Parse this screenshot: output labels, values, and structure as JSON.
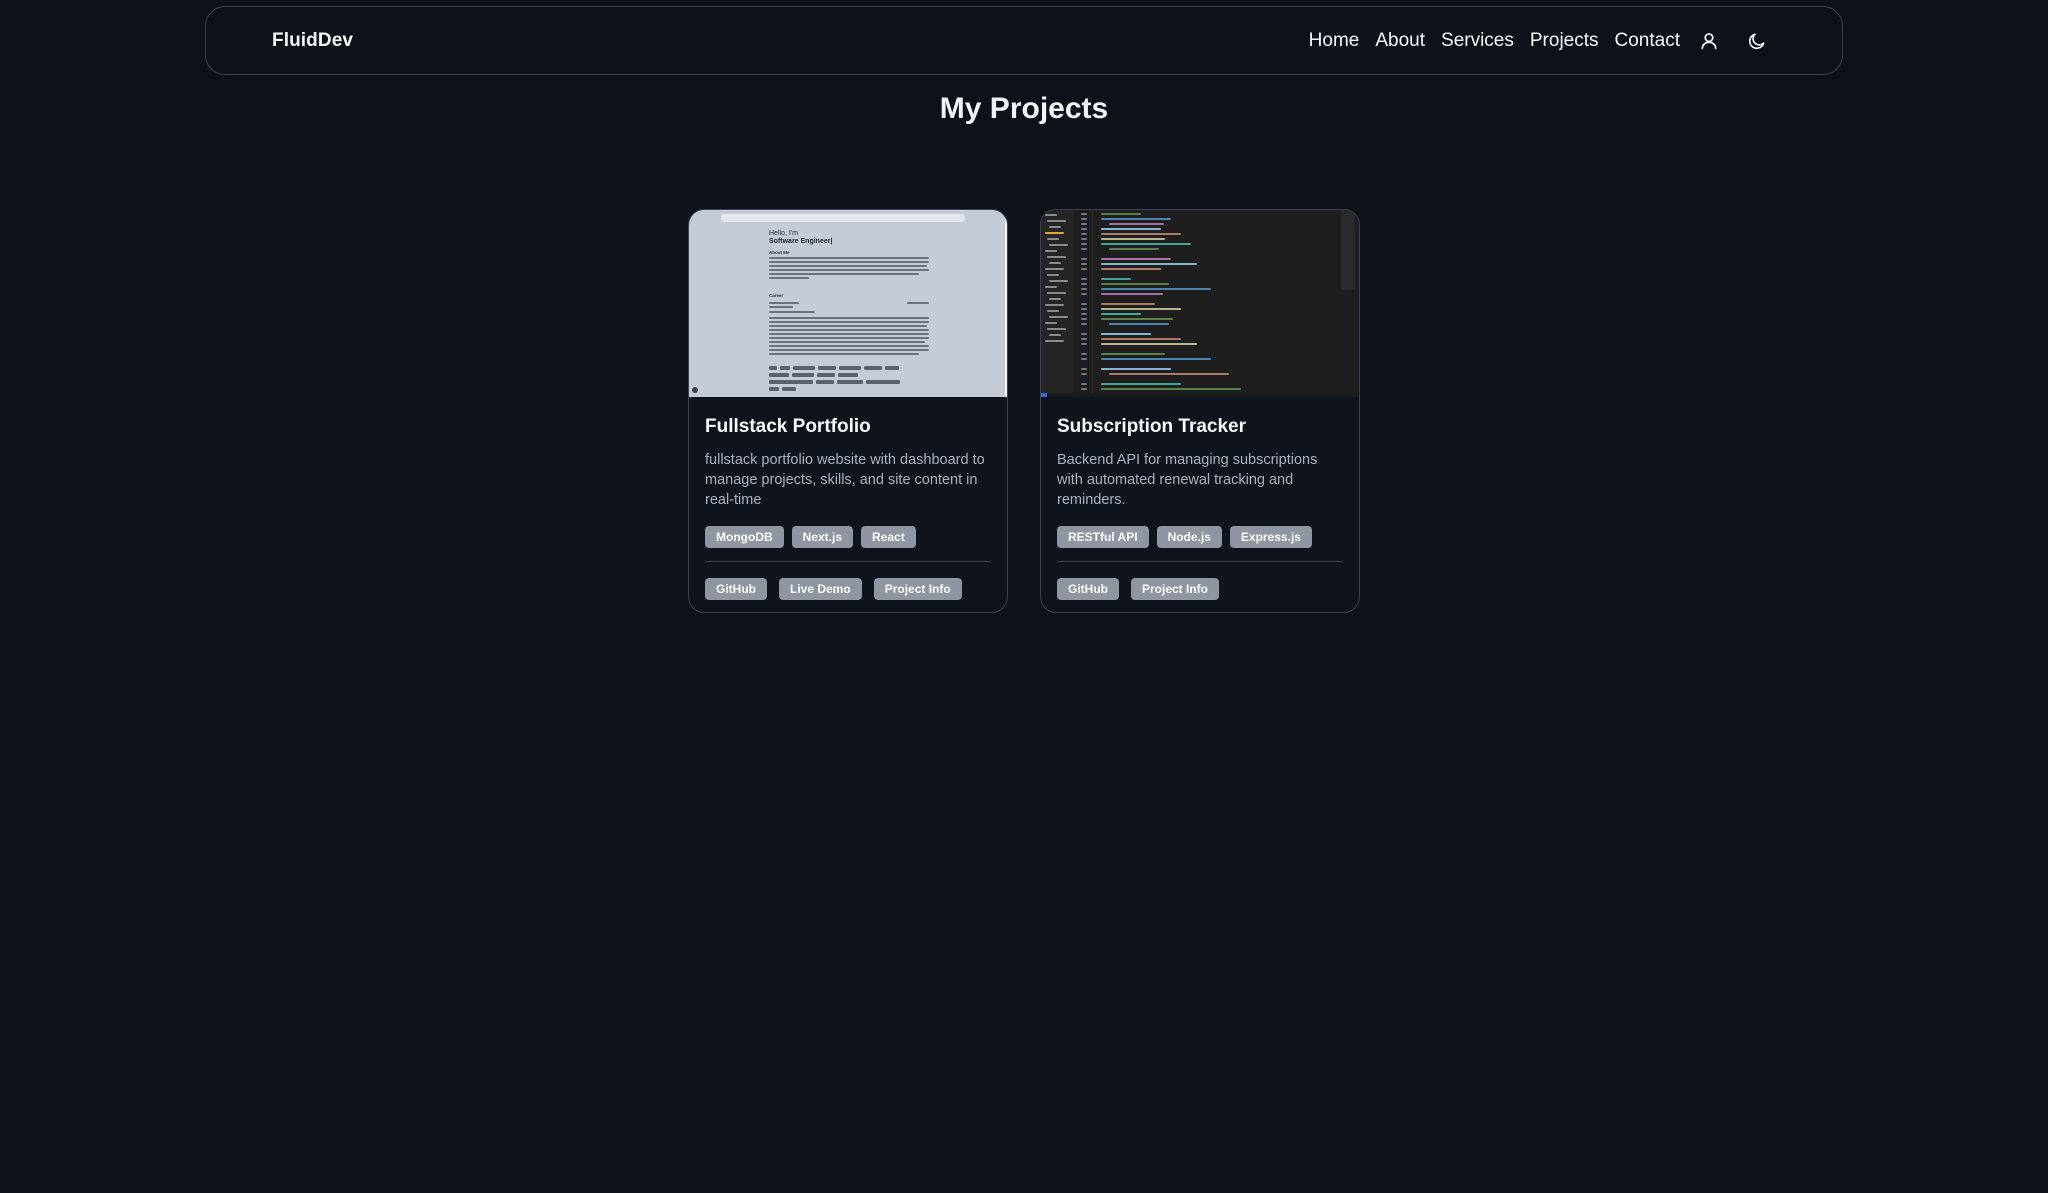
{
  "brand": "FluidDev",
  "nav": {
    "links": [
      "Home",
      "About",
      "Services",
      "Projects",
      "Contact"
    ],
    "user_icon": "user-icon",
    "theme_icon": "moon-icon"
  },
  "page_title": "My Projects",
  "colors": {
    "background": "#0d111a",
    "border": "#3b4150",
    "tag_bg": "#8f95a1",
    "text": "#f8fafc",
    "muted_text": "#aab2c0"
  },
  "projects": [
    {
      "title": "Fullstack Portfolio",
      "description": "fullstack portfolio website with dashboard to manage projects, skills, and site content in real-time",
      "tags": [
        "MongoDB",
        "Next.js",
        "React"
      ],
      "links": [
        "GitHub",
        "Live Demo",
        "Project Info"
      ],
      "preview": {
        "greeting": "Hello, I'm",
        "role": "Software Engineer|",
        "about_heading": "About Me",
        "career_heading": "Career"
      }
    },
    {
      "title": "Subscription Tracker",
      "description": "Backend API for managing subscriptions with automated renewal tracking and reminders.",
      "tags": [
        "RESTful API",
        "Node.js",
        "Express.js"
      ],
      "links": [
        "GitHub",
        "Project Info"
      ]
    }
  ]
}
